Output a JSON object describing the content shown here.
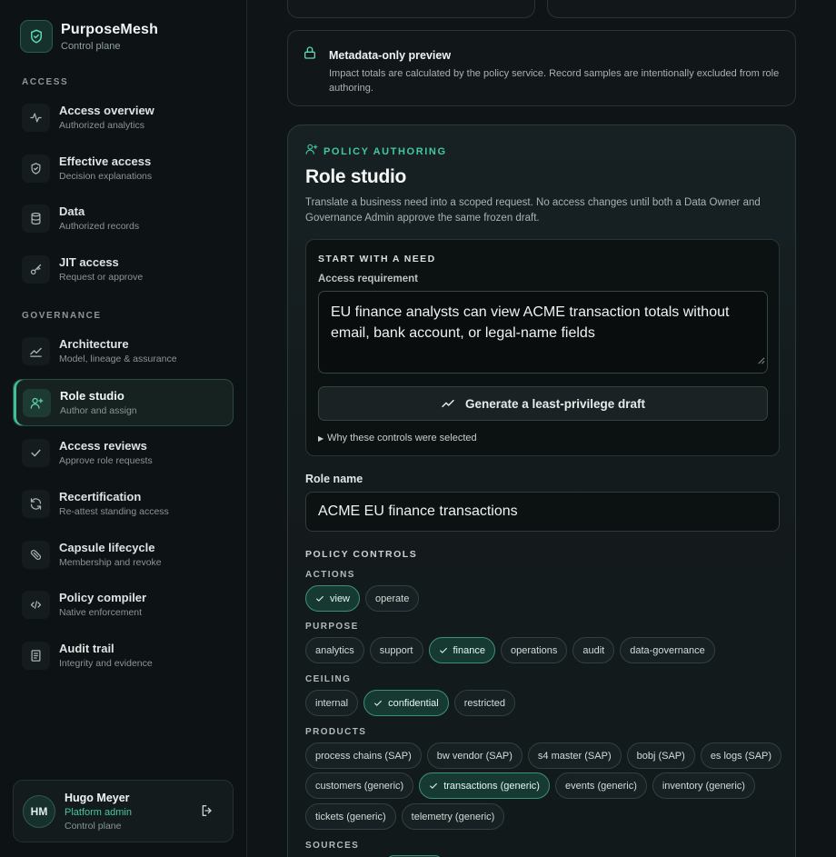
{
  "brand": {
    "title": "PurposeMesh",
    "subtitle": "Control plane"
  },
  "nav": {
    "access_section": "ACCESS",
    "governance_section": "GOVERNANCE",
    "items": [
      {
        "label": "Access overview",
        "sub": "Authorized analytics",
        "icon": "pulse-icon"
      },
      {
        "label": "Effective access",
        "sub": "Decision explanations",
        "icon": "shield-check-icon"
      },
      {
        "label": "Data",
        "sub": "Authorized records",
        "icon": "database-icon"
      },
      {
        "label": "JIT access",
        "sub": "Request or approve",
        "icon": "key-icon"
      },
      {
        "label": "Architecture",
        "sub": "Model, lineage & assurance",
        "icon": "trend-icon"
      },
      {
        "label": "Role studio",
        "sub": "Author and assign",
        "icon": "user-plus-icon",
        "active": true
      },
      {
        "label": "Access reviews",
        "sub": "Approve role requests",
        "icon": "check-icon"
      },
      {
        "label": "Recertification",
        "sub": "Re-attest standing access",
        "icon": "refresh-icon"
      },
      {
        "label": "Capsule lifecycle",
        "sub": "Membership and revoke",
        "icon": "pill-icon"
      },
      {
        "label": "Policy compiler",
        "sub": "Native enforcement",
        "icon": "code-icon"
      },
      {
        "label": "Audit trail",
        "sub": "Integrity and evidence",
        "icon": "document-icon"
      }
    ]
  },
  "user": {
    "initials": "HM",
    "name": "Hugo Meyer",
    "role": "Platform admin",
    "plane": "Control plane"
  },
  "notice": {
    "title": "Metadata-only preview",
    "body": "Impact totals are calculated by the policy service. Record samples are intentionally excluded from role authoring."
  },
  "studio": {
    "eyebrow": "POLICY AUTHORING",
    "title": "Role studio",
    "description": "Translate a business need into a scoped request. No access changes until both a Data Owner and Governance Admin approve the same frozen draft.",
    "need": {
      "eyebrow": "START WITH A NEED",
      "label": "Access requirement",
      "value": "EU finance analysts can view ACME transaction totals without email, bank account, or legal-name fields",
      "generate_label": "Generate a least-privilege draft",
      "why_label": "Why these controls were selected"
    },
    "role_name_label": "Role name",
    "role_name_value": "ACME EU finance transactions",
    "controls_title": "POLICY CONTROLS",
    "groups": {
      "actions": {
        "label": "ACTIONS",
        "chips": [
          {
            "label": "view",
            "selected": true
          },
          {
            "label": "operate"
          }
        ]
      },
      "purpose": {
        "label": "PURPOSE",
        "chips": [
          {
            "label": "analytics"
          },
          {
            "label": "support"
          },
          {
            "label": "finance",
            "selected": true
          },
          {
            "label": "operations"
          },
          {
            "label": "audit"
          },
          {
            "label": "data-governance"
          }
        ]
      },
      "ceiling": {
        "label": "CEILING",
        "chips": [
          {
            "label": "internal"
          },
          {
            "label": "confidential",
            "selected": true
          },
          {
            "label": "restricted"
          }
        ]
      },
      "products": {
        "label": "PRODUCTS",
        "chips": [
          {
            "label": "process chains (SAP)"
          },
          {
            "label": "bw vendor (SAP)"
          },
          {
            "label": "s4 master (SAP)"
          },
          {
            "label": "bobj (SAP)"
          },
          {
            "label": "es logs (SAP)"
          },
          {
            "label": "customers (generic)"
          },
          {
            "label": "transactions (generic)",
            "selected": true
          },
          {
            "label": "events (generic)"
          },
          {
            "label": "inventory (generic)"
          },
          {
            "label": "tickets (generic)"
          },
          {
            "label": "telemetry (generic)"
          }
        ]
      },
      "sources": {
        "label": "SOURCES"
      }
    }
  },
  "colors": {
    "accent": "#45c7a0",
    "background": "#0f1416",
    "selected_chip": "#163a32"
  }
}
